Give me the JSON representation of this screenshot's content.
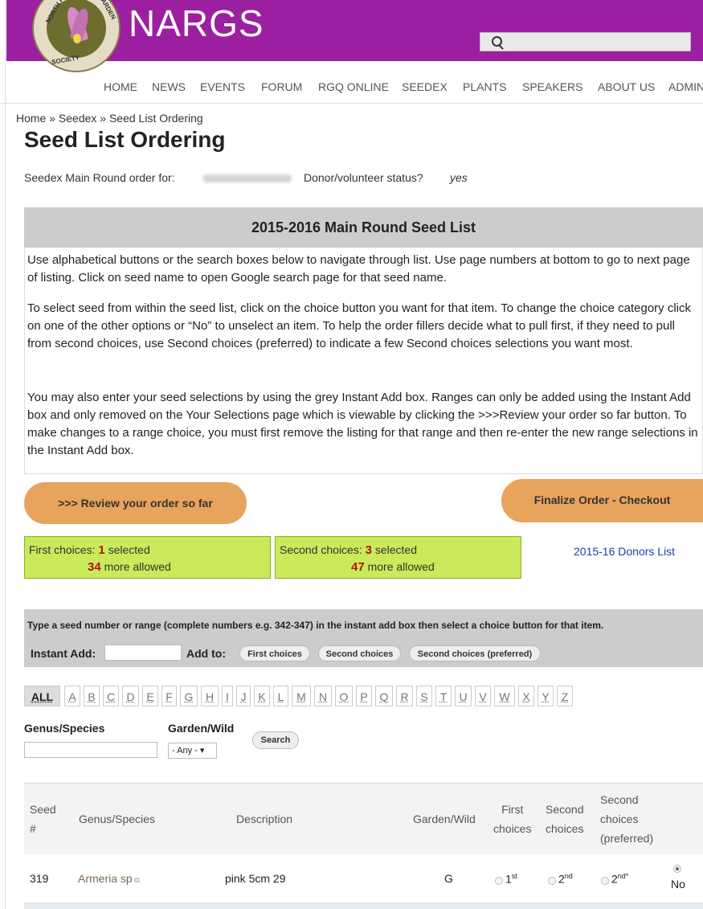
{
  "header": {
    "logo_text": "NARGS",
    "logo_ring": {
      "top": "NORTH A",
      "right": "GARDEN",
      "bottom": "SOCIETY"
    },
    "search_value": ""
  },
  "nav": [
    "HOME",
    "NEWS",
    "EVENTS",
    "FORUM",
    "RGQ ONLINE",
    "SEEDEX",
    "PLANTS",
    "SPEAKERS",
    "ABOUT US",
    "ADMIN"
  ],
  "breadcrumb": "Home » Seedex » Seed List Ordering",
  "page_title": "Seed List Ordering",
  "order_for_label": "Seedex Main Round order for:",
  "donor_label": "Donor/volunteer status?",
  "donor_value": "yes",
  "seed_list": {
    "title": "2015-2016 Main Round Seed List",
    "paragraphs": [
      "Use alphabetical buttons or the search boxes below to navigate through list. Use page numbers at bottom to go to next page of listing. Click on seed name to open Google search page for that seed name.",
      "To select seed from within the seed list, click on the choice button you want for that item. To change the choice category click on one of the other options or “No” to unselect an item. To help the order fillers decide what to pull first, if they need to pull from second choices, use Second choices (preferred) to indicate a few Second choices selections you want most.",
      "You may also enter your seed selections by using the grey Instant Add box. Ranges can only be added using the Instant Add box and only removed on the Your Selections page which is viewable by clicking the >>>Review your order so far button. To make changes to a range choice, you must first remove the listing for that range and then re-enter the new range selections in the Instant Add box."
    ]
  },
  "buttons": {
    "review": ">>> Review your order so far",
    "finalize": "Finalize Order - Checkout"
  },
  "first_choices": {
    "label": "First choices:",
    "selected": "1",
    "selected_text": "selected",
    "more": "34",
    "more_text": "more allowed"
  },
  "second_choices": {
    "label": "Second choices:",
    "selected": "3",
    "selected_text": "selected",
    "more": "47",
    "more_text": "more allowed"
  },
  "donors_link": "2015-16 Donors List",
  "instant_add": {
    "instructions": "Type a seed number or range (complete numbers e.g. 342-347) in the instant add box then select a choice button for that item.",
    "label": "Instant Add:",
    "value": "",
    "add_to_label": "Add to:",
    "options": [
      "First choices",
      "Second choices",
      "Second choices (preferred)"
    ]
  },
  "alphabet": [
    "ALL",
    "A",
    "B",
    "C",
    "D",
    "E",
    "F",
    "G",
    "H",
    "I",
    "J",
    "K",
    "L",
    "M",
    "N",
    "O",
    "P",
    "Q",
    "R",
    "S",
    "T",
    "U",
    "V",
    "W",
    "X",
    "Y",
    "Z"
  ],
  "filters": {
    "genus_label": "Genus/Species",
    "garden_label": "Garden/Wild",
    "genus_value": "",
    "garden_value": "- Any -",
    "search_button": "Search"
  },
  "table": {
    "headers": {
      "seed_1": "Seed",
      "seed_2": "#",
      "genus": "Genus/Species",
      "description": "Description",
      "garden": "Garden/Wild",
      "first_1": "First",
      "first_2": "choices",
      "second_1": "Second",
      "second_2": "choices",
      "pref_1": "Second",
      "pref_2": "choices",
      "pref_3": "(preferred)"
    },
    "rows": [
      {
        "seed": "319",
        "genus": "Armeria sp",
        "description": "pink 5cm 29",
        "garden": "G",
        "opt1": "1",
        "opt1_sup": "st",
        "opt2": "2",
        "opt2_sup": "nd",
        "opt3": "2",
        "opt3_sup": "nd*",
        "no": "No",
        "selected": "No"
      }
    ]
  }
}
